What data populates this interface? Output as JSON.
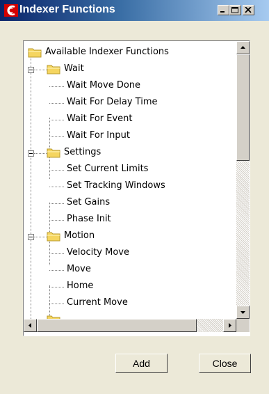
{
  "window": {
    "title": "Indexer Functions",
    "controls": [
      "minimize",
      "maximize",
      "close"
    ]
  },
  "tree": {
    "root": {
      "label": "Available Indexer Functions",
      "icon": "folder-icon"
    },
    "groups": [
      {
        "label": "Wait",
        "expanded": true,
        "items": [
          "Wait Move Done",
          "Wait For Delay Time",
          "Wait For Event",
          "Wait For Input"
        ]
      },
      {
        "label": "Settings",
        "expanded": true,
        "items": [
          "Set Current Limits",
          "Set Tracking Windows",
          "Set Gains",
          "Phase Init"
        ]
      },
      {
        "label": "Motion",
        "expanded": true,
        "items": [
          "Velocity Move",
          "Move",
          "Home",
          "Current Move"
        ]
      }
    ]
  },
  "buttons": {
    "add": "Add",
    "close": "Close"
  },
  "colors": {
    "title_start": "#0a246a",
    "title_end": "#a6caf0",
    "dialog_bg": "#ece9d8",
    "folder": "#f5d55f"
  }
}
